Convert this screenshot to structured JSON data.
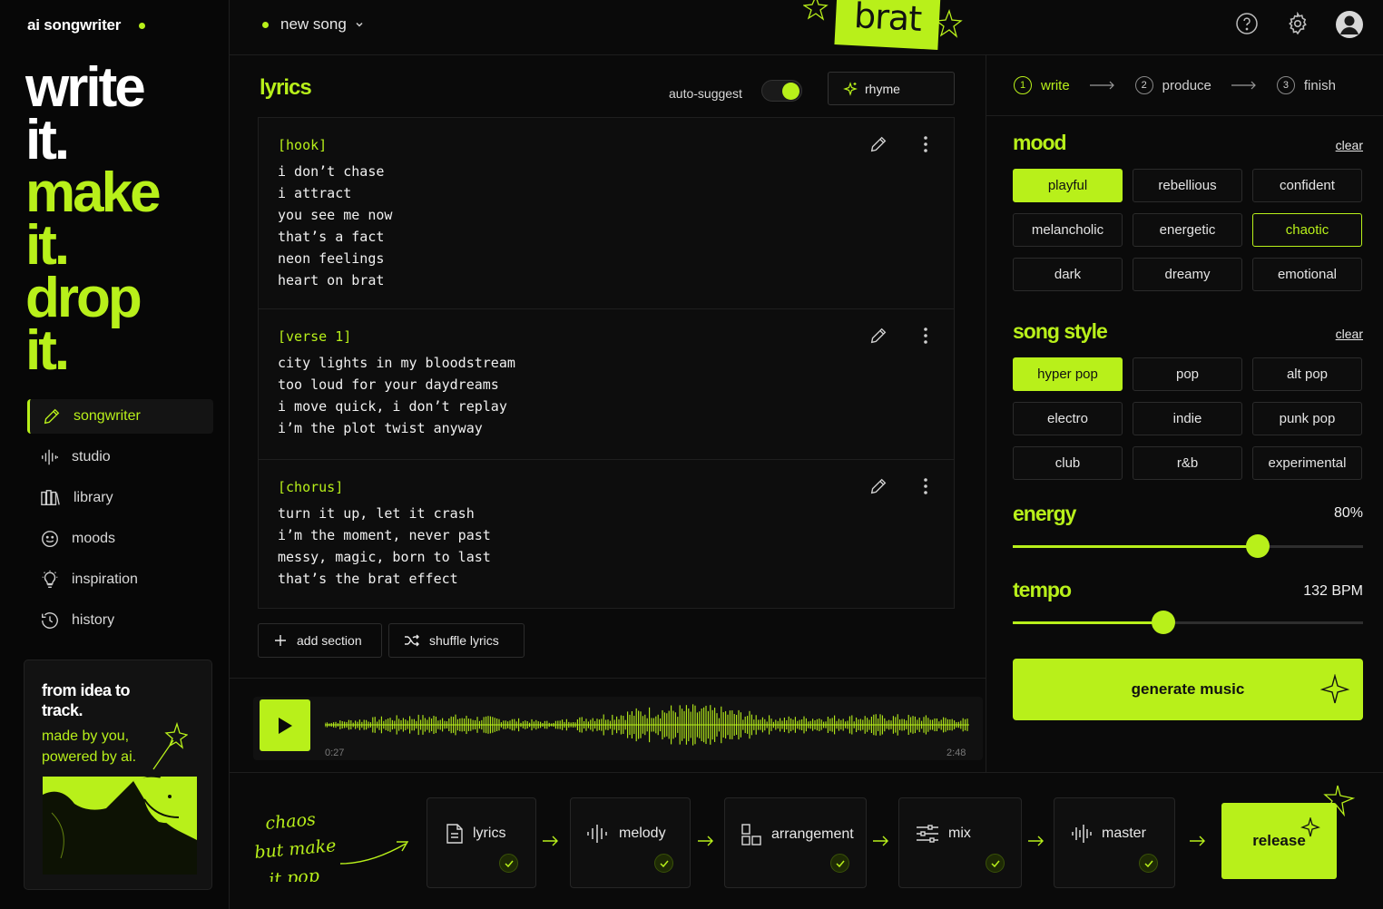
{
  "brand": {
    "name": "ai songwriter"
  },
  "hero": {
    "l1": "write",
    "l2": "it.",
    "l3": "make",
    "l4": "it.",
    "l5": "drop",
    "l6": "it."
  },
  "nav": {
    "songwriter": "songwriter",
    "studio": "studio",
    "library": "library",
    "moods": "moods",
    "inspiration": "inspiration",
    "history": "history"
  },
  "promo": {
    "title": "from idea to track.",
    "subtitle": "made by you, powered by ai."
  },
  "topbar": {
    "song": "new song",
    "sticker": "brat"
  },
  "lyrics": {
    "title": "lyrics",
    "auto_suggest": "auto-suggest",
    "auto_suggest_on": true,
    "rhyme": "rhyme",
    "sections": [
      {
        "tag": "[hook]",
        "lines": [
          "i don’t chase",
          "i attract",
          "you see me now",
          "that’s a fact",
          "neon feelings",
          "heart on brat"
        ]
      },
      {
        "tag": "[verse 1]",
        "lines": [
          "city lights in my bloodstream",
          "too loud for your daydreams",
          "i move quick, i don’t replay",
          "i’m the plot twist anyway"
        ]
      },
      {
        "tag": "[chorus]",
        "lines": [
          "turn it up, let it crash",
          "i’m the moment, never past",
          "messy, magic, born to last",
          "that’s the brat effect"
        ]
      }
    ],
    "add_section": "add section",
    "shuffle": "shuffle lyrics"
  },
  "player": {
    "current": "0:27",
    "total": "2:48"
  },
  "steps": {
    "s1": "write",
    "s1n": "1",
    "s2": "produce",
    "s2n": "2",
    "s3": "finish",
    "s3n": "3"
  },
  "mood": {
    "title": "mood",
    "clear": "clear",
    "options": [
      "playful",
      "rebellious",
      "confident",
      "melancholic",
      "energetic",
      "chaotic",
      "dark",
      "dreamy",
      "emotional"
    ],
    "selected": "playful",
    "highlighted": "chaotic"
  },
  "style": {
    "title": "song style",
    "clear": "clear",
    "options": [
      "hyper pop",
      "pop",
      "alt pop",
      "electro",
      "indie",
      "punk pop",
      "club",
      "r&b",
      "experimental"
    ],
    "selected": "hyper pop"
  },
  "energy": {
    "title": "energy",
    "value": "80%",
    "level": 0.7
  },
  "tempo": {
    "title": "tempo",
    "value": "132 BPM",
    "level": 0.43
  },
  "generate": "generate music",
  "bottom": {
    "slogan1": "chaos",
    "slogan2": "but make",
    "slogan3": "it pop",
    "stages": {
      "lyrics": "lyrics",
      "melody": "melody",
      "arrangement": "arrangement",
      "mix": "mix",
      "master": "master"
    },
    "release": "release"
  },
  "colors": {
    "accent": "#b8f01a",
    "bg": "#0a0a0a"
  }
}
